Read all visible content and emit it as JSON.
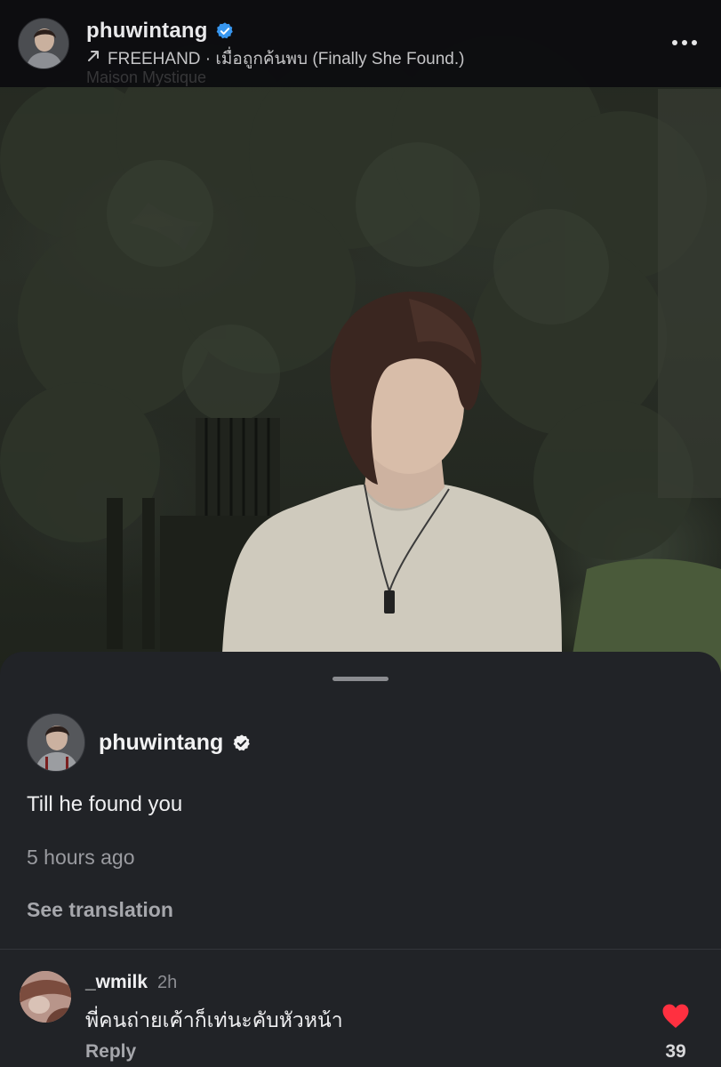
{
  "header": {
    "username": "phuwintang",
    "music": "FREEHAND · เมื่อถูกค้นพบ (Finally She Found.)",
    "location": "Maison Mystique",
    "icons": {
      "verified": "verified-badge-icon",
      "music_arrow": "arrow-up-right-icon",
      "more": "more-horizontal-icon"
    }
  },
  "post": {
    "username": "phuwintang",
    "caption": "Till he found you",
    "timestamp": "5 hours ago",
    "see_translation": "See translation"
  },
  "comment": {
    "username": "_wmilk",
    "time": "2h",
    "text": "พี่คนถ่ายเค้าก็เท่นะคับหัวหน้า",
    "reply_label": "Reply",
    "like_count": "39",
    "liked": true
  },
  "colors": {
    "verified_blue": "#3897f0",
    "like_red": "#ff3040",
    "sheet_bg": "#212327"
  }
}
